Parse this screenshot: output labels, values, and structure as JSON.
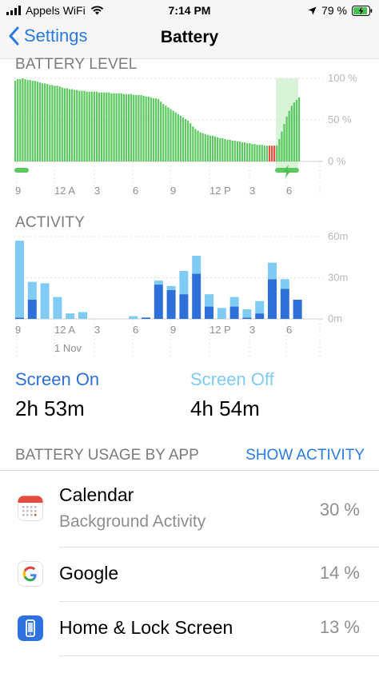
{
  "status_bar": {
    "carrier": "Appels WiFi",
    "time": "7:14 PM",
    "battery_percent": "79 %",
    "icons": [
      "signal-icon",
      "wifi-icon",
      "location-arrow-icon",
      "battery-charging-icon"
    ]
  },
  "nav": {
    "back_label": "Settings",
    "title": "Battery"
  },
  "battery_chart": {
    "label": "BATTERY LEVEL",
    "y_ticks": [
      "100 %",
      "50 %",
      "0 %"
    ],
    "x_ticks": [
      "9",
      "12 A",
      "3",
      "6",
      "9",
      "12 P",
      "3",
      "6"
    ],
    "colors": {
      "normal": "#5cc860",
      "low": "#ea4a3f",
      "charging_band": "#d9f3d9"
    }
  },
  "activity_chart": {
    "label": "ACTIVITY",
    "y_ticks": [
      "60m",
      "30m",
      "0m"
    ],
    "x_ticks": [
      "9",
      "12 A",
      "3",
      "6",
      "9",
      "12 P",
      "3",
      "6"
    ],
    "date_label": "1 Nov",
    "colors": {
      "screen_on": "#2e6fd9",
      "screen_off": "#7fcbf3"
    }
  },
  "chart_data": [
    {
      "type": "bar",
      "title": "BATTERY LEVEL",
      "ylim": [
        0,
        100
      ],
      "x_tick_labels": [
        "9",
        "12 A",
        "3",
        "6",
        "9",
        "12 P",
        "3",
        "6"
      ],
      "y_tick_labels": [
        "100 %",
        "50 %",
        "0 %"
      ],
      "values": [
        97,
        99,
        99,
        100,
        99,
        98,
        98,
        97,
        97,
        96,
        95,
        94,
        94,
        93,
        92,
        92,
        91,
        91,
        90,
        89,
        88,
        88,
        87,
        87,
        86,
        86,
        85,
        85,
        85,
        84,
        84,
        84,
        84,
        84,
        83,
        83,
        83,
        83,
        83,
        82,
        82,
        82,
        82,
        82,
        81,
        81,
        81,
        81,
        80,
        80,
        80,
        80,
        79,
        78,
        78,
        77,
        76,
        76,
        75,
        72,
        69,
        67,
        65,
        63,
        61,
        59,
        57,
        55,
        53,
        51,
        49,
        46,
        42,
        39,
        37,
        35,
        34,
        33,
        32,
        31,
        31,
        30,
        29,
        28,
        28,
        27,
        26,
        26,
        25,
        25,
        24,
        24,
        23,
        23,
        22,
        22,
        21,
        21,
        20,
        20,
        20,
        19,
        19,
        19,
        19,
        19,
        19,
        27,
        36,
        45,
        54,
        61,
        67,
        71,
        74,
        77
      ],
      "low_range": [
        103,
        106
      ],
      "charging_range": [
        106,
        115
      ]
    },
    {
      "type": "bar",
      "title": "ACTIVITY",
      "ylim": [
        0,
        60
      ],
      "x_tick_labels": [
        "9",
        "12 A",
        "3",
        "6",
        "9",
        "12 P",
        "3",
        "6"
      ],
      "y_tick_labels": [
        "60m",
        "30m",
        "0m"
      ],
      "series": [
        {
          "name": "Screen On",
          "values": [
            1,
            14,
            0,
            0,
            0,
            0,
            0,
            0,
            0,
            0,
            1,
            25,
            21,
            18,
            33,
            9,
            0,
            9,
            1,
            4,
            29,
            22,
            14
          ]
        },
        {
          "name": "Screen Off",
          "values": [
            56,
            13,
            26,
            16,
            4,
            5,
            0,
            0,
            0,
            2,
            0,
            3,
            3,
            17,
            13,
            9,
            8,
            7,
            6,
            9,
            12,
            7,
            0
          ]
        }
      ]
    }
  ],
  "summary": {
    "screen_on": {
      "label": "Screen On",
      "value": "2h 53m",
      "color": "#2e6fd9"
    },
    "screen_off": {
      "label": "Screen Off",
      "value": "4h 54m",
      "color": "#7fcbf3"
    }
  },
  "usage": {
    "title": "BATTERY USAGE BY APP",
    "action": "SHOW ACTIVITY",
    "apps": [
      {
        "name": "Calendar",
        "subtitle": "Background Activity",
        "percent": "30 %",
        "icon": "calendar-icon"
      },
      {
        "name": "Google",
        "subtitle": "",
        "percent": "14 %",
        "icon": "google-icon"
      },
      {
        "name": "Home & Lock Screen",
        "subtitle": "",
        "percent": "13 %",
        "icon": "home-lock-screen-icon"
      }
    ]
  }
}
